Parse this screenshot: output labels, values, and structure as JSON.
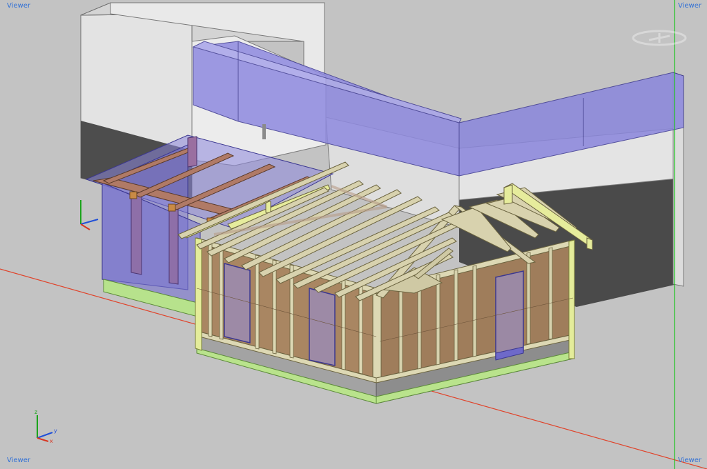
{
  "viewport": {
    "label_top_left": "Viewer",
    "label_top_right": "Viewer",
    "label_bottom_left": "Viewer",
    "label_bottom_right": "Viewer",
    "background_color": "#c3c3c3"
  },
  "axes_gizmo": {
    "z_label": "z",
    "y_label": "y",
    "x_label": "x",
    "z_color": "#1aa31a",
    "y_color": "#1f4fd8",
    "x_color": "#d8341f"
  },
  "scene": {
    "view_cube_icon": "navigation-cube-icon",
    "colors": {
      "red_axis": "#e0432a",
      "green_axis": "#19c41c",
      "wall_sheathing": "#a98662",
      "stud": "#d9d4b0",
      "rafter": "#d2ccaa",
      "purple_glass": "#7a76d6",
      "foundation": "#9a9a9a",
      "sill_green": "#b8e38d",
      "dark_wall": "#4a4a4a",
      "light_wall": "#e6e6e6"
    }
  }
}
